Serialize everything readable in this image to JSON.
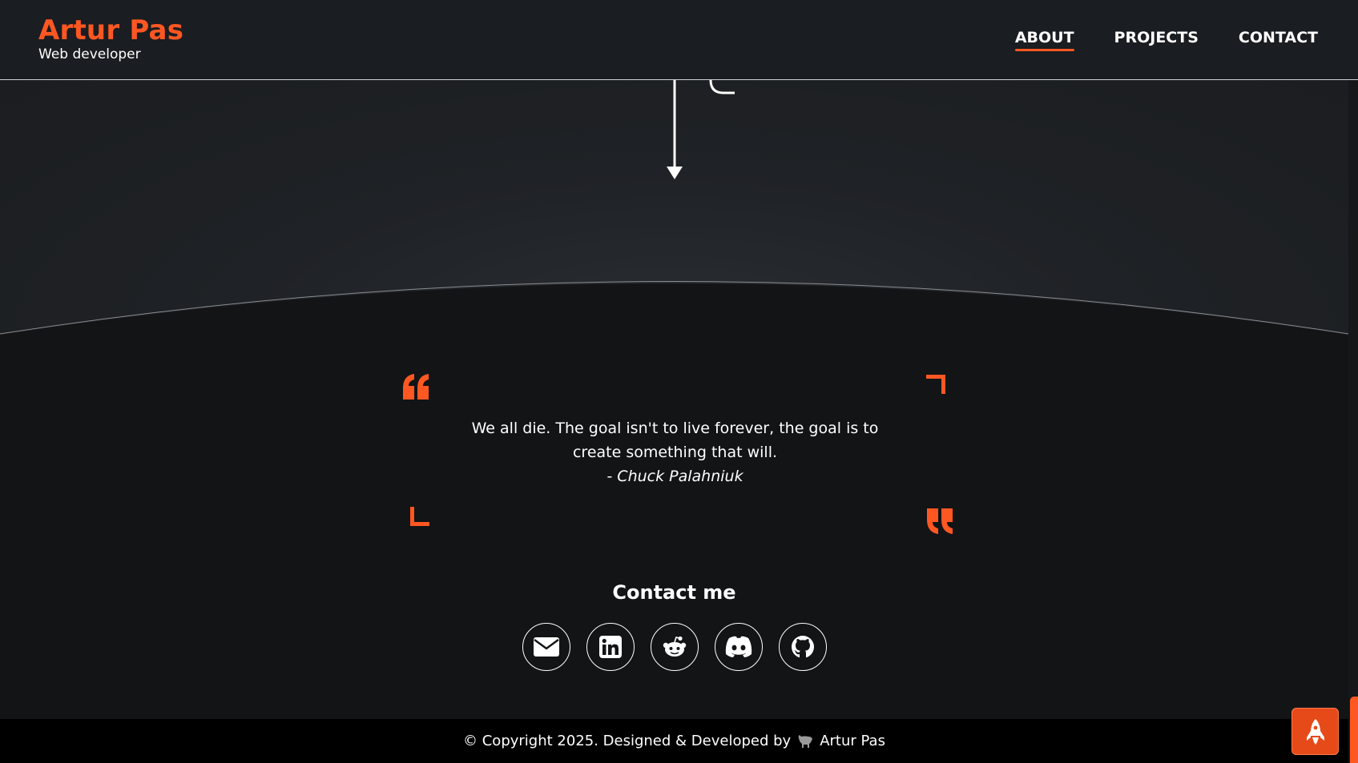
{
  "header": {
    "brand_name": "Artur Pas",
    "brand_subtitle": "Web developer",
    "nav": [
      {
        "label": "ABOUT",
        "active": true
      },
      {
        "label": "PROJECTS",
        "active": false
      },
      {
        "label": "CONTACT",
        "active": false
      }
    ]
  },
  "quote": {
    "text": "We all die. The goal isn't to live forever, the goal is to create something that will.",
    "author": "- Chuck Palahniuk"
  },
  "contact": {
    "title": "Contact me",
    "links": [
      {
        "icon": "envelope-icon"
      },
      {
        "icon": "linkedin-icon"
      },
      {
        "icon": "reddit-icon"
      },
      {
        "icon": "discord-icon"
      },
      {
        "icon": "github-icon"
      }
    ]
  },
  "footer": {
    "text": "© Copyright 2025. Designed & Developed by",
    "author": "Artur Pas"
  },
  "colors": {
    "accent": "#ff5722",
    "background": "#121416",
    "header": "#1a1d21",
    "footer": "#000000"
  }
}
